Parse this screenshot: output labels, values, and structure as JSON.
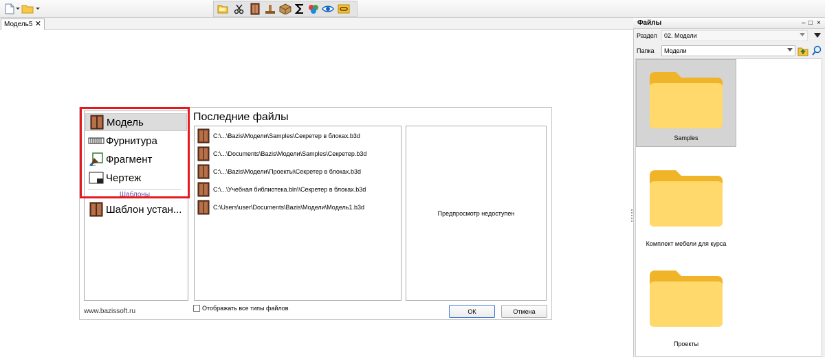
{
  "toolbar": {
    "left_icons": [
      "new-document-icon",
      "open-folder-icon"
    ],
    "center_icons": [
      "folder-open-icon",
      "scissors-icon",
      "cabinet-icon",
      "stamp-icon",
      "box-icon",
      "sigma-icon",
      "palette-icon",
      "eye-icon",
      "link-icon"
    ]
  },
  "document_tab": {
    "label": "Модель5",
    "close": "✕"
  },
  "start_dialog": {
    "types": [
      {
        "label": "Модель",
        "icon": "model-cabinet-icon",
        "selected": true
      },
      {
        "label": "Фурнитура",
        "icon": "hardware-icon",
        "selected": false
      },
      {
        "label": "Фрагмент",
        "icon": "fragment-icon",
        "selected": false
      },
      {
        "label": "Чертеж",
        "icon": "drawing-icon",
        "selected": false
      }
    ],
    "templates_label": "Шаблоны",
    "template_item": {
      "label": "Шаблон устан...",
      "icon": "model-cabinet-icon"
    },
    "recent_title": "Последние файлы",
    "recent_files": [
      "C:\\...\\Bazis\\Модели\\Samples\\Секретер в блоках.b3d",
      "C:\\...\\Documents\\Bazis\\Модели\\Samples\\Секретер.b3d",
      "C:\\...\\Bazis\\Модели\\Проекты\\Секретер в блоках.b3d",
      "C:\\...\\Учебная библиотека.bln\\\\Секретер в блоках.b3d",
      "C:\\Users\\user\\Documents\\Bazis\\Модели\\Модель1.b3d"
    ],
    "preview_text": "Предпросмотр недоступен",
    "site": "www.bazissoft.ru",
    "show_all_label": "Отображать все типы файлов",
    "show_all_checked": false,
    "ok_label": "ОК",
    "cancel_label": "Отмена",
    "highlight_color": "#e5191e"
  },
  "files_panel": {
    "title": "Файлы",
    "controls": {
      "minimize": "–",
      "maximize": "□",
      "close": "×"
    },
    "section_label": "Раздел",
    "section_value": "02. Модели",
    "folder_label": "Папка",
    "folder_value": "Модели",
    "folders": [
      {
        "name": "Samples",
        "selected": true
      },
      {
        "name": "Комплект мебели для курса",
        "selected": false
      },
      {
        "name": "Проекты",
        "selected": false
      }
    ]
  }
}
